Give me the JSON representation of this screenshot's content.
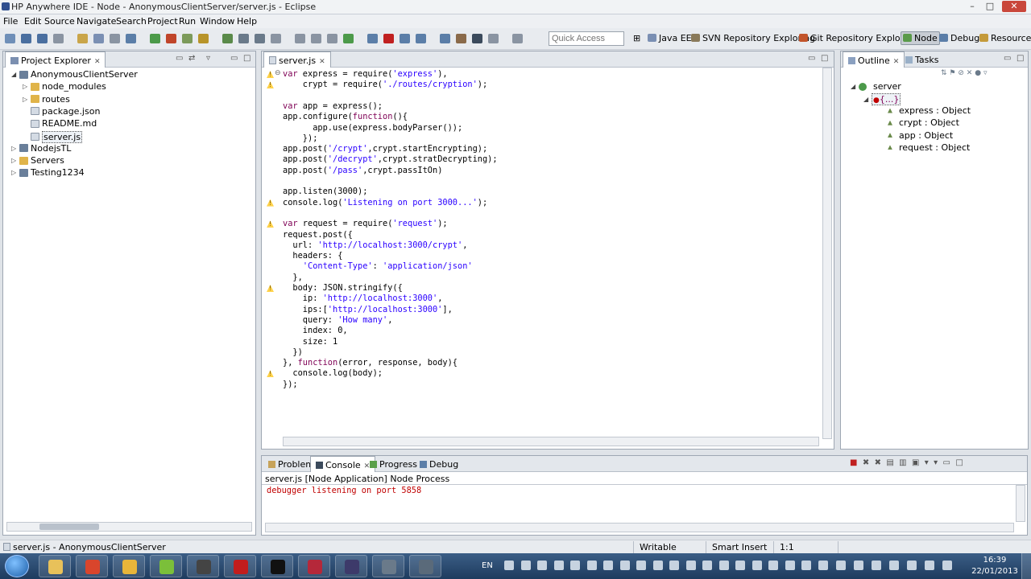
{
  "window": {
    "title": "HP Anywhere IDE - Node - AnonymousClientServer/server.js - Eclipse",
    "minimize": "–",
    "maximize": "□",
    "close": "✕"
  },
  "menu": [
    "File",
    "Edit",
    "Source",
    "Navigate",
    "Search",
    "Project",
    "Run",
    "Window",
    "Help"
  ],
  "toolbar": {
    "quick_access_placeholder": "Quick Access",
    "perspectives": [
      {
        "label": "Java EE",
        "color": "#7a8fb3",
        "active": false
      },
      {
        "label": "SVN Repository Exploring",
        "color": "#8a7a5a",
        "active": false
      },
      {
        "label": "Git Repository Exploring",
        "color": "#c2542b",
        "active": false
      },
      {
        "label": "Node",
        "color": "#5a9a4a",
        "active": true
      },
      {
        "label": "Debug",
        "color": "#5b7ea8",
        "active": false
      },
      {
        "label": "Resource",
        "color": "#c49a3a",
        "active": false
      }
    ]
  },
  "project_explorer": {
    "tab_label": "Project Explorer",
    "close": "✕",
    "tree": [
      {
        "label": "AnonymousClientServer",
        "level": 0,
        "arrow": "◢",
        "icon": "project"
      },
      {
        "label": "node_modules",
        "level": 1,
        "arrow": "▷",
        "icon": "folder"
      },
      {
        "label": "routes",
        "level": 1,
        "arrow": "▷",
        "icon": "folder"
      },
      {
        "label": "package.json",
        "level": 1,
        "arrow": "",
        "icon": "file"
      },
      {
        "label": "README.md",
        "level": 1,
        "arrow": "",
        "icon": "file"
      },
      {
        "label": "server.js",
        "level": 1,
        "arrow": "",
        "icon": "file",
        "selected": true
      },
      {
        "label": "NodejsTL",
        "level": 0,
        "arrow": "▷",
        "icon": "project"
      },
      {
        "label": "Servers",
        "level": 0,
        "arrow": "▷",
        "icon": "folder"
      },
      {
        "label": "Testing1234",
        "level": 0,
        "arrow": "▷",
        "icon": "project"
      }
    ]
  },
  "editor": {
    "tab_label": "server.js",
    "close": "✕",
    "lines": [
      "var express = require('express'),",
      "    crypt = require('./routes/cryption');",
      "",
      "var app = express();",
      "app.configure(function(){",
      "      app.use(express.bodyParser());",
      "    });",
      "app.post('/crypt',crypt.startEncrypting);",
      "app.post('/decrypt',crypt.stratDecrypting);",
      "app.post('/pass',crypt.passItOn)",
      "",
      "app.listen(3000);",
      "console.log('Listening on port 3000...');",
      "",
      "var request = require('request');",
      "request.post({",
      "  url: 'http://localhost:3000/crypt',",
      "  headers: {",
      "    'Content-Type': 'application/json'",
      "  },",
      "  body: JSON.stringify({",
      "    ip: 'http://localhost:3000',",
      "    ips:['http://localhost:3000'],",
      "    query: 'How many',",
      "    index: 0,",
      "    size: 1",
      "  })",
      "}, function(error, response, body){",
      "  console.log(body);",
      "});"
    ],
    "warning_lines": [
      0,
      1,
      12,
      14,
      20,
      28
    ],
    "warning_glyph": "!",
    "fold_glyph": "⊖"
  },
  "outline": {
    "tabs": [
      {
        "label": "Outline",
        "active": true
      },
      {
        "label": "Tasks",
        "active": false
      }
    ],
    "close": "✕",
    "root": "server",
    "node": "{...}",
    "items": [
      "express : Object",
      "crypt : Object",
      "app : Object",
      "request : Object"
    ]
  },
  "console": {
    "tabs": [
      {
        "label": "Problems",
        "active": false
      },
      {
        "label": "Console",
        "active": true
      },
      {
        "label": "Progress",
        "active": false
      },
      {
        "label": "Debug",
        "active": false
      }
    ],
    "close": "✕",
    "process": "server.js [Node Application] Node Process",
    "output": "debugger listening on port 5858"
  },
  "status": {
    "selection": "server.js - AnonymousClientServer",
    "writable": "Writable",
    "insert_mode": "Smart Insert",
    "position": "1:1"
  },
  "taskbar": {
    "lang": "EN",
    "time": "16:39",
    "date": "22/01/2013",
    "apps": [
      {
        "name": "explorer",
        "color": "#e8c15a"
      },
      {
        "name": "chrome",
        "color": "#d9452c"
      },
      {
        "name": "messenger",
        "color": "#e8b53a"
      },
      {
        "name": "android",
        "color": "#7bbf3a"
      },
      {
        "name": "cmd-dark",
        "color": "#444"
      },
      {
        "name": "acrobat",
        "color": "#c21d1d"
      },
      {
        "name": "terminal",
        "color": "#111"
      },
      {
        "name": "red-app",
        "color": "#b5283a"
      },
      {
        "name": "eclipse",
        "color": "#3d3a6a"
      },
      {
        "name": "tool",
        "color": "#6a7a8a"
      },
      {
        "name": "tool2",
        "color": "#5a6a7a"
      }
    ]
  },
  "colors": {
    "keyword": "#7f0055",
    "string": "#2a00ff",
    "console_output": "#c00000",
    "warning": "#ffd24a"
  }
}
